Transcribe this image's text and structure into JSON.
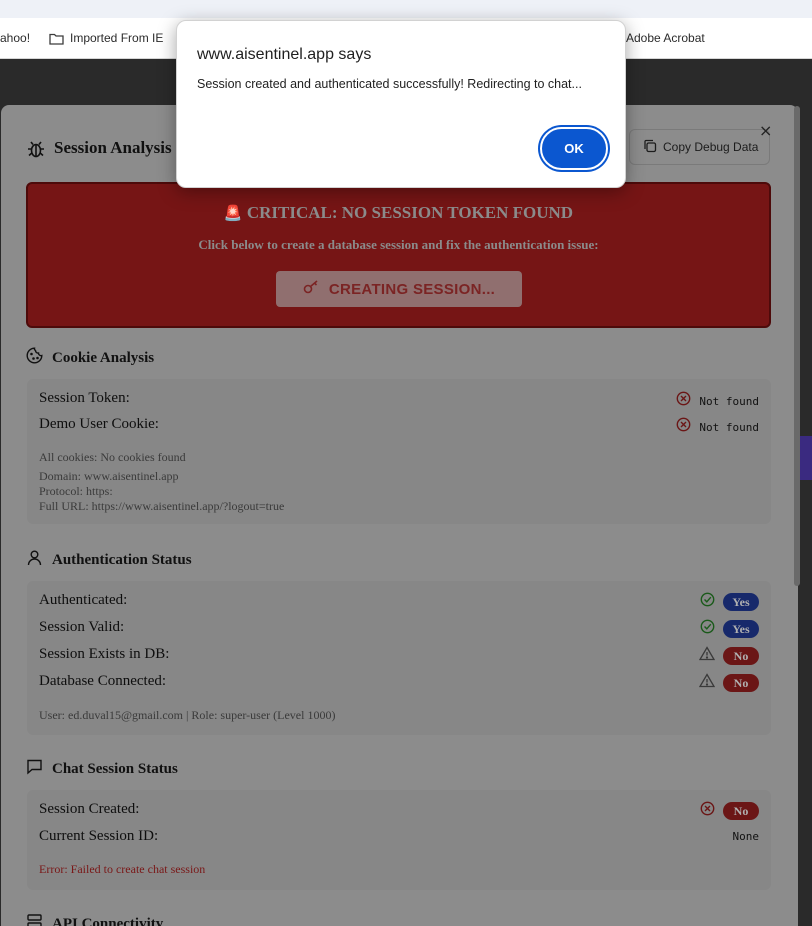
{
  "bookmarks": {
    "items": [
      {
        "label": "ahoo!"
      },
      {
        "label": "Imported From IE"
      },
      {
        "label": "Adobe Acrobat"
      }
    ]
  },
  "alert": {
    "title": "www.aisentinel.app says",
    "message": "Session created and authenticated successfully! Redirecting to chat...",
    "ok_label": "OK"
  },
  "modal": {
    "title": "Session Analysis",
    "copy_label": "Copy Debug Data",
    "close_glyph": "×",
    "critical": {
      "icon": "🚨",
      "title": "CRITICAL: NO SESSION TOKEN FOUND",
      "subtitle": "Click below to create a database session and fix the authentication issue:",
      "button_label": "CREATING SESSION..."
    },
    "cookie": {
      "title": "Cookie Analysis",
      "rows": [
        {
          "label": "Session Token:",
          "value": "Not found"
        },
        {
          "label": "Demo User Cookie:",
          "value": "Not found"
        }
      ],
      "all_cookies": "All cookies: No cookies found",
      "domain": "Domain: www.aisentinel.app",
      "protocol": "Protocol: https:",
      "full_url": "Full URL: https://www.aisentinel.app/?logout=true"
    },
    "auth": {
      "title": "Authentication Status",
      "rows": [
        {
          "label": "Authenticated:",
          "value": "Yes"
        },
        {
          "label": "Session Valid:",
          "value": "Yes"
        },
        {
          "label": "Session Exists in DB:",
          "value": "No"
        },
        {
          "label": "Database Connected:",
          "value": "No"
        }
      ],
      "user_info": "User: ed.duval15@gmail.com | Role: super-user (Level 1000)"
    },
    "chat": {
      "title": "Chat Session Status",
      "rows": [
        {
          "label": "Session Created:",
          "value": "No"
        },
        {
          "label": "Current Session ID:",
          "value": "None"
        }
      ],
      "error": "Error: Failed to create chat session"
    },
    "api": {
      "title": "API Connectivity"
    }
  },
  "colors": {
    "alert_ok": "#0b57d0",
    "critical_bg": "#761515",
    "yes_pill": "#17296b",
    "no_pill": "#6b1616"
  }
}
